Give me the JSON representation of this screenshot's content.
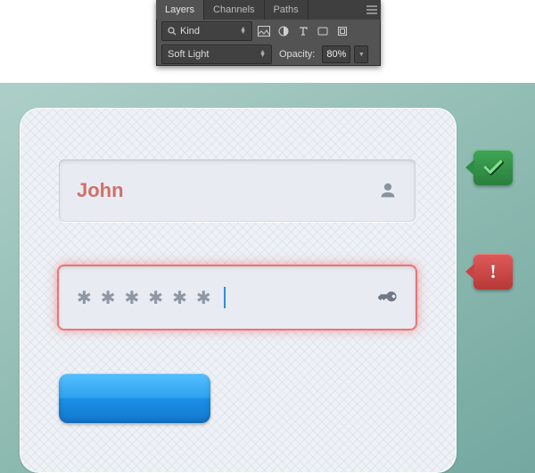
{
  "ps_panel": {
    "tabs": {
      "layers": "Layers",
      "channels": "Channels",
      "paths": "Paths"
    },
    "kind_label": "Kind",
    "blend_mode": "Soft Light",
    "opacity_label": "Opacity:",
    "opacity_value": "80%"
  },
  "login": {
    "username_value": "John",
    "password_mask": "******",
    "callouts": {
      "error_glyph": "!"
    }
  }
}
